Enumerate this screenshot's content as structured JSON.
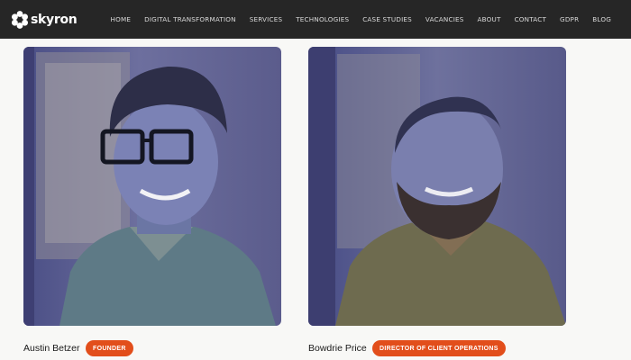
{
  "brand": {
    "name": "skyron",
    "logo_icon": "skyron-flower-mark"
  },
  "nav": {
    "items": [
      {
        "label": "HOME"
      },
      {
        "label": "DIGITAL TRANSFORMATION"
      },
      {
        "label": "SERVICES"
      },
      {
        "label": "TECHNOLOGIES"
      },
      {
        "label": "CASE STUDIES"
      },
      {
        "label": "VACANCIES"
      },
      {
        "label": "ABOUT"
      },
      {
        "label": "CONTACT"
      },
      {
        "label": "GDPR"
      },
      {
        "label": "BLOG"
      }
    ]
  },
  "team": [
    {
      "name": "Austin Betzer",
      "role": "FOUNDER"
    },
    {
      "name": "Bowdrie Price",
      "role": "DIRECTOR OF CLIENT OPERATIONS"
    }
  ],
  "colors": {
    "topbar_bg": "#262626",
    "accent": "#e24e1b",
    "page_bg": "#f8f8f6"
  }
}
